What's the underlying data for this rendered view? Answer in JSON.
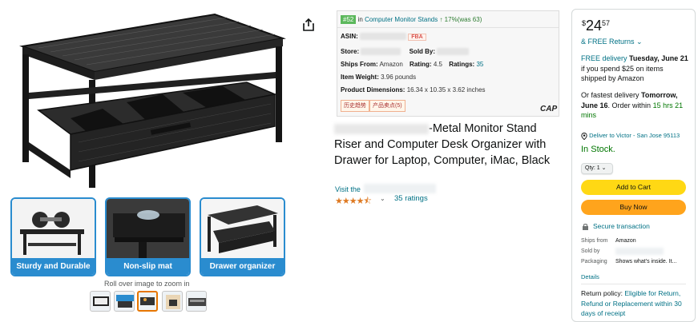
{
  "gallery": {
    "features": [
      {
        "caption": "Sturdy and Durable"
      },
      {
        "caption": "Non-slip mat"
      },
      {
        "caption": "Drawer organizer"
      }
    ],
    "zoom_hint": "Roll over image to zoom in",
    "thumb_count": 5,
    "selected_thumb": 2
  },
  "info": {
    "rank": "#52",
    "rank_in": "in",
    "rank_category": "Computer Monitor Stands",
    "rank_change": "↑ 17%(was 63)",
    "asin_label": "ASIN:",
    "fba": "FBA",
    "store_label": "Store:",
    "sold_by_label": "Sold By:",
    "ships_from_label": "Ships From:",
    "ships_from_value": "Amazon",
    "rating_label": "Rating:",
    "rating_value": "4.5",
    "ratings_label": "Ratings:",
    "ratings_value": "35",
    "weight_label": "Item Weight:",
    "weight_value": "3.96 pounds",
    "dims_label": "Product Dimensions:",
    "dims_value": "16.34 x 10.35 x 3.62 inches",
    "tag1": "历史趋势",
    "tag2": "产品卖点(5)",
    "logo": "CAP"
  },
  "product": {
    "title": "-Metal Monitor Stand Riser and Computer Desk Organizer with Drawer for Laptop, Computer, iMac, Black",
    "visit": "Visit the",
    "stars": "★★★★⯪",
    "ratings": "35 ratings"
  },
  "buybox": {
    "price_symbol": "$",
    "price_whole": "24",
    "price_fraction": "57",
    "returns": "& FREE Returns ⌄",
    "delivery_free": "FREE delivery",
    "delivery_date": "Tuesday, June 21",
    "delivery_cond": "if you spend $25 on items shipped by Amazon",
    "fastest_pre": "Or fastest delivery",
    "fastest_day": "Tomorrow,",
    "fastest_date": "June 16",
    "fastest_mid": ". Order within",
    "fastest_time": "15 hrs 21 mins",
    "deliver_to": "Deliver to Victor - San Jose 95113",
    "stock": "In Stock.",
    "qty": "Qty: 1",
    "add_to_cart": "Add to Cart",
    "buy_now": "Buy Now",
    "secure": "Secure transaction",
    "ships_from_label": "Ships from",
    "ships_from_value": "Amazon",
    "sold_by_label": "Sold by",
    "packaging_label": "Packaging",
    "packaging_value": "Shows what's inside. It...",
    "details": "Details",
    "return_label": "Return policy:",
    "return_link": "Eligible for Return, Refund or Replacement within 30 days of receipt",
    "colors": {
      "add_cart": "#FFD814",
      "buy_now": "#FFA41C",
      "link": "#007185",
      "stock": "#007600"
    }
  }
}
